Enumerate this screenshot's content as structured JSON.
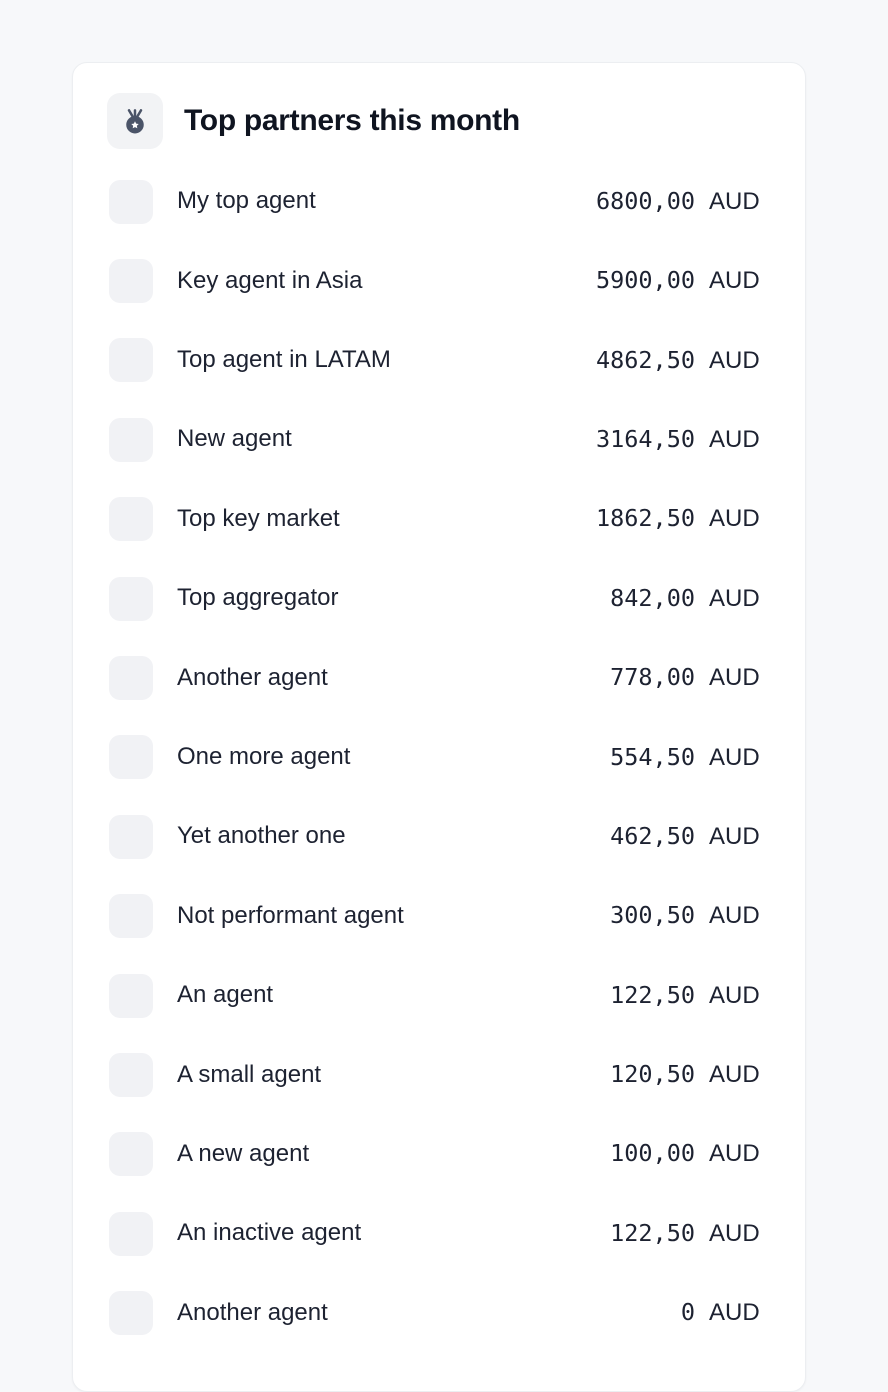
{
  "background_color": "#f7f8fa",
  "card": {
    "background_color": "#ffffff",
    "border_color": "#eceef1"
  },
  "header": {
    "icon": "medal-icon",
    "icon_color": "#4b5468",
    "icon_badge_color": "#f2f3f5",
    "title": "Top partners this month"
  },
  "list": {
    "currency": "AUD",
    "rows": [
      {
        "avatar": "avatar-placeholder",
        "name": "My top agent",
        "amount": "6800,00",
        "currency": "AUD"
      },
      {
        "avatar": "avatar-placeholder",
        "name": "Key agent in Asia",
        "amount": "5900,00",
        "currency": "AUD"
      },
      {
        "avatar": "avatar-placeholder",
        "name": "Top agent in LATAM",
        "amount": "4862,50",
        "currency": "AUD"
      },
      {
        "avatar": "avatar-placeholder",
        "name": "New agent",
        "amount": "3164,50",
        "currency": "AUD"
      },
      {
        "avatar": "avatar-placeholder",
        "name": "Top key market",
        "amount": "1862,50",
        "currency": "AUD"
      },
      {
        "avatar": "avatar-placeholder",
        "name": "Top aggregator",
        "amount": "842,00",
        "currency": "AUD"
      },
      {
        "avatar": "avatar-placeholder",
        "name": "Another agent",
        "amount": "778,00",
        "currency": "AUD"
      },
      {
        "avatar": "avatar-placeholder",
        "name": "One more agent",
        "amount": "554,50",
        "currency": "AUD"
      },
      {
        "avatar": "avatar-placeholder",
        "name": "Yet another one",
        "amount": "462,50",
        "currency": "AUD"
      },
      {
        "avatar": "avatar-placeholder",
        "name": "Not performant agent",
        "amount": "300,50",
        "currency": "AUD"
      },
      {
        "avatar": "avatar-placeholder",
        "name": "An agent",
        "amount": "122,50",
        "currency": "AUD"
      },
      {
        "avatar": "avatar-placeholder",
        "name": "A small agent",
        "amount": "120,50",
        "currency": "AUD"
      },
      {
        "avatar": "avatar-placeholder",
        "name": "A new agent",
        "amount": "100,00",
        "currency": "AUD"
      },
      {
        "avatar": "avatar-placeholder",
        "name": "An inactive agent",
        "amount": "122,50",
        "currency": "AUD"
      },
      {
        "avatar": "avatar-placeholder",
        "name": "Another agent",
        "amount": "0",
        "currency": "AUD"
      }
    ]
  }
}
